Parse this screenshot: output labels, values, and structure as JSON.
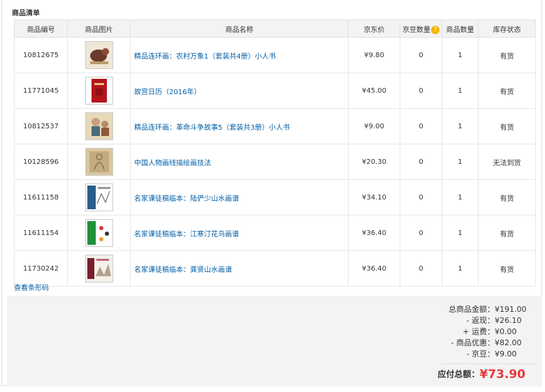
{
  "section_title": "商品清单",
  "columns": [
    "商品编号",
    "商品图片",
    "商品名称",
    "京东价",
    "京豆数量",
    "商品数量",
    "库存状态"
  ],
  "help_icon": "question-icon",
  "rows": [
    {
      "id": "10812675",
      "name": "精品连环画：农村万象1（套装共4册）小人书",
      "price": "¥9.80",
      "beans": "0",
      "qty": "1",
      "stock": "有货",
      "out_of_stock": false,
      "thumb": "book-cover-comic-1"
    },
    {
      "id": "11771045",
      "name": "故宫日历（2016年）",
      "price": "¥45.00",
      "beans": "0",
      "qty": "1",
      "stock": "有货",
      "out_of_stock": false,
      "thumb": "book-cover-calendar"
    },
    {
      "id": "10812537",
      "name": "精品连环画：革命斗争故事5（套装共3册）小人书",
      "price": "¥9.00",
      "beans": "0",
      "qty": "1",
      "stock": "有货",
      "out_of_stock": false,
      "thumb": "book-cover-comic-2"
    },
    {
      "id": "10128596",
      "name": "中国人物画线描绘画技法",
      "price": "¥20.30",
      "beans": "0",
      "qty": "1",
      "stock": "无法到货",
      "out_of_stock": true,
      "thumb": "book-cover-figure"
    },
    {
      "id": "11611158",
      "name": "名家课徒稿临本：陆俨少山水画谱",
      "price": "¥34.10",
      "beans": "0",
      "qty": "1",
      "stock": "有货",
      "out_of_stock": false,
      "thumb": "book-cover-landscape"
    },
    {
      "id": "11611154",
      "name": "名家课徒稿临本：江寒汀花鸟画谱",
      "price": "¥36.40",
      "beans": "0",
      "qty": "1",
      "stock": "有货",
      "out_of_stock": false,
      "thumb": "book-cover-birds"
    },
    {
      "id": "11730242",
      "name": "名家课徒稿临本：龚贤山水画谱",
      "price": "¥36.40",
      "beans": "0",
      "qty": "1",
      "stock": "有货",
      "out_of_stock": false,
      "thumb": "book-cover-landscape-2"
    }
  ],
  "barcode_link": "查看条形码",
  "summary": {
    "lines": [
      {
        "label": "总商品金额：",
        "value": "¥191.00"
      },
      {
        "label": "- 返现：",
        "value": "¥26.10"
      },
      {
        "label": "+ 运费：",
        "value": "¥0.00"
      },
      {
        "label": "- 商品优惠：",
        "value": "¥82.00"
      },
      {
        "label": "- 京豆：",
        "value": "¥9.00"
      }
    ],
    "total_label": "应付总额：",
    "total_value": "¥73.90"
  },
  "colors": {
    "link": "#005ea7",
    "price": "#e4393c",
    "header_bg": "#f3f3f3"
  }
}
